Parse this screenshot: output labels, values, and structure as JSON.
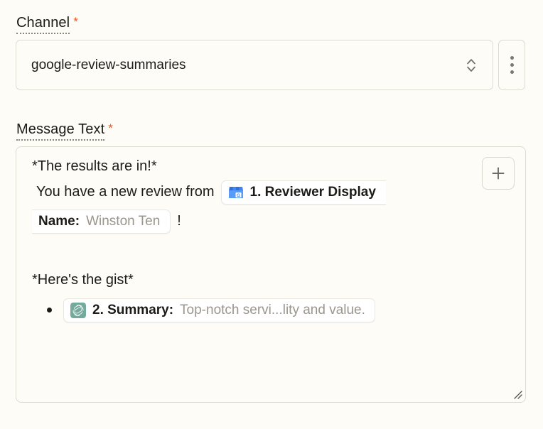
{
  "theme": {
    "page_bg": "#fdfcf6",
    "border": "#dedad0",
    "text": "#1d1b18",
    "muted_text": "#9b968d",
    "required_star": "#f0561e",
    "chip_bg": "#ffffff",
    "chip_border": "#ebe7dd",
    "google_icon_blue": "#4285f4",
    "openai_icon_green": "#74aa9c"
  },
  "fields": {
    "channel": {
      "label": "Channel",
      "required_marker": "*",
      "value": "google-review-summaries",
      "dropdown_icon": "chevron-up-down-icon",
      "more_menu_icon": "kebab-menu-icon"
    },
    "message_text": {
      "label": "Message Text",
      "required_marker": "*",
      "add_button_icon": "plus-icon",
      "resize_handle_icon": "resize-grip-icon",
      "content": {
        "line1": "*The results are in!*",
        "line2_prefix": "You have a new review from",
        "token1": {
          "icon": "google-business-profile-icon",
          "label_head": "1. Reviewer Display",
          "label_tail": "Name:",
          "value": "Winston Ten",
          "suffix": "!"
        },
        "line3": "*Here's the gist*",
        "token2": {
          "bullet": "•",
          "icon": "openai-icon",
          "label": "2. Summary:",
          "value": "Top-notch servi...lity and value."
        }
      }
    }
  }
}
